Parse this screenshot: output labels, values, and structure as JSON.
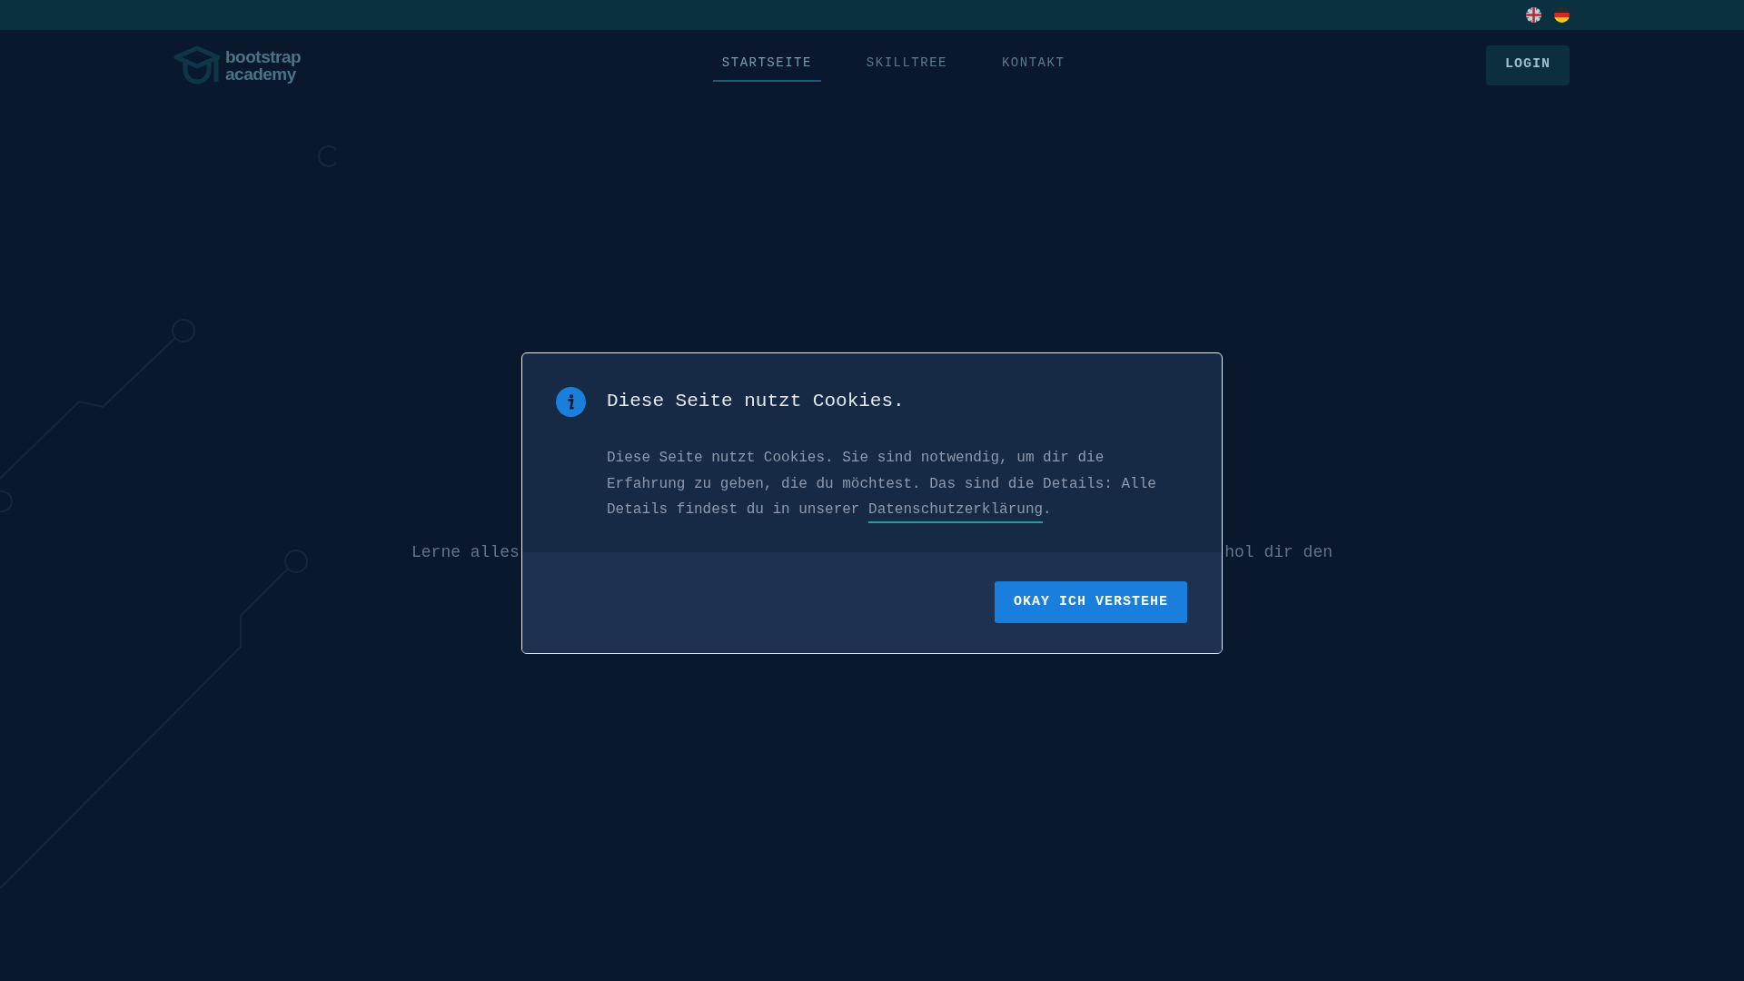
{
  "top_bar": {
    "languages": [
      {
        "kind": "uk"
      },
      {
        "kind": "de"
      }
    ]
  },
  "navbar": {
    "logo": {
      "line_1": "bootstrap",
      "line_2": "academy"
    },
    "links": [
      {
        "label": "STARTSEITE",
        "selected": true
      },
      {
        "label": "SKILLTREE",
        "selected": false
      },
      {
        "label": "KONTAKT",
        "selected": false
      }
    ],
    "login_button": "LOGIN"
  },
  "hero": {
    "text_left": "Lerne alles",
    "text_right": "hol dir den"
  },
  "cookie_dialog": {
    "title": "Diese Seite nutzt Cookies.",
    "body": {
      "text": "Diese Seite nutzt Cookies. Sie sind notwendig, um dir die Erfahrung zu geben, die du möchtest. Das sind die Details: Alle Details findest du in unserer ",
      "link": "Datenschutzerklärung",
      "text_after": "."
    },
    "button": "OKAY ICH VERSTEHE"
  }
}
